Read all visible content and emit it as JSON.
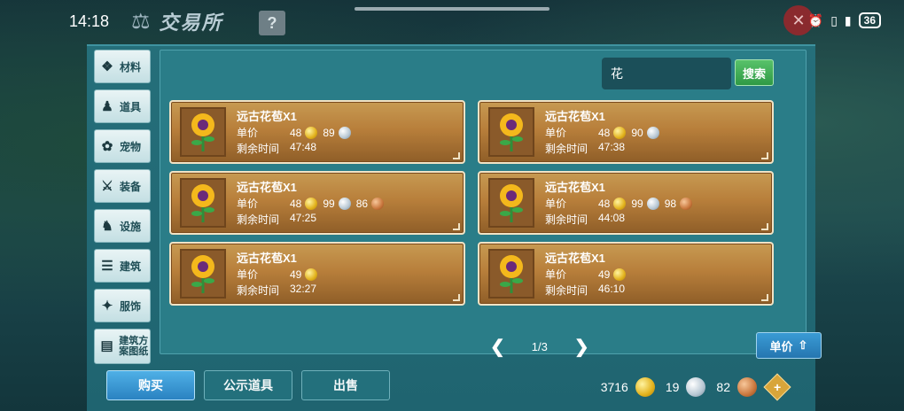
{
  "status": {
    "time": "14:18",
    "battery": "36"
  },
  "header": {
    "title": "交易所",
    "help": "?"
  },
  "sidebar": {
    "items": [
      {
        "label": "材料",
        "icon": "materials-icon"
      },
      {
        "label": "道具",
        "icon": "props-icon"
      },
      {
        "label": "宠物",
        "icon": "pet-paw-icon"
      },
      {
        "label": "装备",
        "icon": "equipment-icon"
      },
      {
        "label": "设施",
        "icon": "facility-icon"
      },
      {
        "label": "建筑",
        "icon": "building-icon"
      },
      {
        "label": "服饰",
        "icon": "clothing-icon"
      },
      {
        "label": "建筑方案图纸",
        "icon": "blueprint-icon"
      }
    ]
  },
  "search": {
    "value": "花",
    "button": "搜索"
  },
  "listings": [
    {
      "name": "远古花苞X1",
      "price_label": "单价",
      "gold": "48",
      "silver": "89",
      "copper": "",
      "time_label": "剩余时间",
      "time": "47:48"
    },
    {
      "name": "远古花苞X1",
      "price_label": "单价",
      "gold": "48",
      "silver": "90",
      "copper": "",
      "time_label": "剩余时间",
      "time": "47:38"
    },
    {
      "name": "远古花苞X1",
      "price_label": "单价",
      "gold": "48",
      "silver": "99",
      "copper": "86",
      "time_label": "剩余时间",
      "time": "47:25"
    },
    {
      "name": "远古花苞X1",
      "price_label": "单价",
      "gold": "48",
      "silver": "99",
      "copper": "98",
      "time_label": "剩余时间",
      "time": "44:08"
    },
    {
      "name": "远古花苞X1",
      "price_label": "单价",
      "gold": "49",
      "silver": "",
      "copper": "",
      "time_label": "剩余时间",
      "time": "32:27"
    },
    {
      "name": "远古花苞X1",
      "price_label": "单价",
      "gold": "49",
      "silver": "",
      "copper": "",
      "time_label": "剩余时间",
      "time": "46:10"
    }
  ],
  "pager": {
    "page": "1/3"
  },
  "sort": {
    "label": "单价"
  },
  "tabs": {
    "buy": "购买",
    "public": "公示道具",
    "sell": "出售"
  },
  "wallet": {
    "gold": "3716",
    "silver": "19",
    "copper": "82"
  },
  "colors": {
    "panel": "#256f7a",
    "card": "#b87f3b",
    "buy_tab": "#2a82c1",
    "search_btn": "#2f9a45"
  }
}
